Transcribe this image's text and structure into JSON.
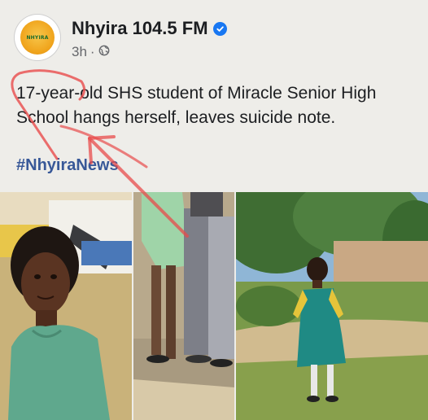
{
  "post": {
    "page_name": "Nhyira 104.5 FM",
    "logo_text": "NHYIRA",
    "time": "3h",
    "separator": "·",
    "text": "17-year-old SHS student of Miracle Senior High School hangs herself, leaves suicide note.",
    "hashtag": "#NhyiraNews"
  },
  "icons": {
    "verified": "verified-badge-icon",
    "audience": "globe-icon",
    "annotation": "red-arrow-annotation"
  },
  "colors": {
    "verified": "#1877f2",
    "hashtag": "#385898",
    "annotation": "#e84b4b"
  }
}
